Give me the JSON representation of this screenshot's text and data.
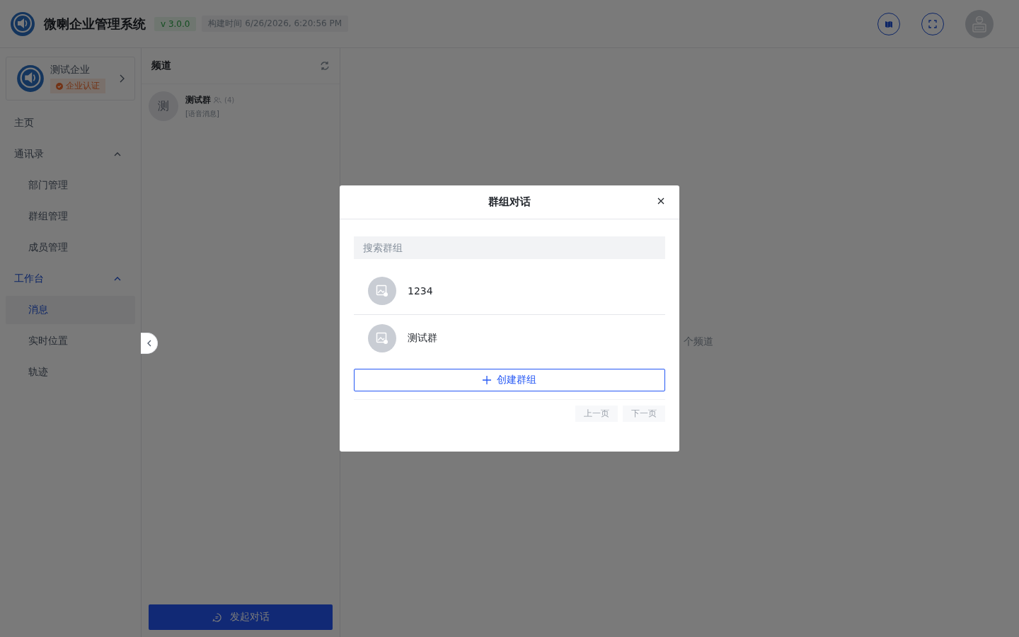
{
  "header": {
    "title": "微喇企业管理系统",
    "version": "v 3.0.0",
    "build_time": "构建时间 6/26/2026, 6:20:56 PM"
  },
  "sidebar": {
    "company": {
      "name": "测试企业",
      "badge": "企业认证"
    },
    "items": [
      {
        "label": "主页",
        "selected": false
      },
      {
        "label": "通讯录",
        "expanded": true,
        "selected": false,
        "children": [
          {
            "label": "部门管理",
            "selected": false
          },
          {
            "label": "群组管理",
            "selected": false
          },
          {
            "label": "成员管理",
            "selected": false
          }
        ]
      },
      {
        "label": "工作台",
        "expanded": true,
        "selected": true,
        "children": [
          {
            "label": "消息",
            "selected": true
          },
          {
            "label": "实时位置",
            "selected": false
          },
          {
            "label": "轨迹",
            "selected": false
          }
        ]
      }
    ]
  },
  "channels": {
    "title": "频道",
    "items": [
      {
        "avatar": "测",
        "name": "测试群",
        "count": "(4)",
        "preview": "[语音消息]"
      }
    ],
    "start_button": "发起对话"
  },
  "main": {
    "empty_text": "个频道"
  },
  "dialog": {
    "title": "群组对话",
    "search": {
      "placeholder": "搜索群组"
    },
    "groups": [
      {
        "name": "1234"
      },
      {
        "name": "测试群"
      }
    ],
    "create_button": "创建群组",
    "prev_button": "上一页",
    "next_button": "下一页",
    "prev_disabled": true,
    "next_disabled": true
  }
}
